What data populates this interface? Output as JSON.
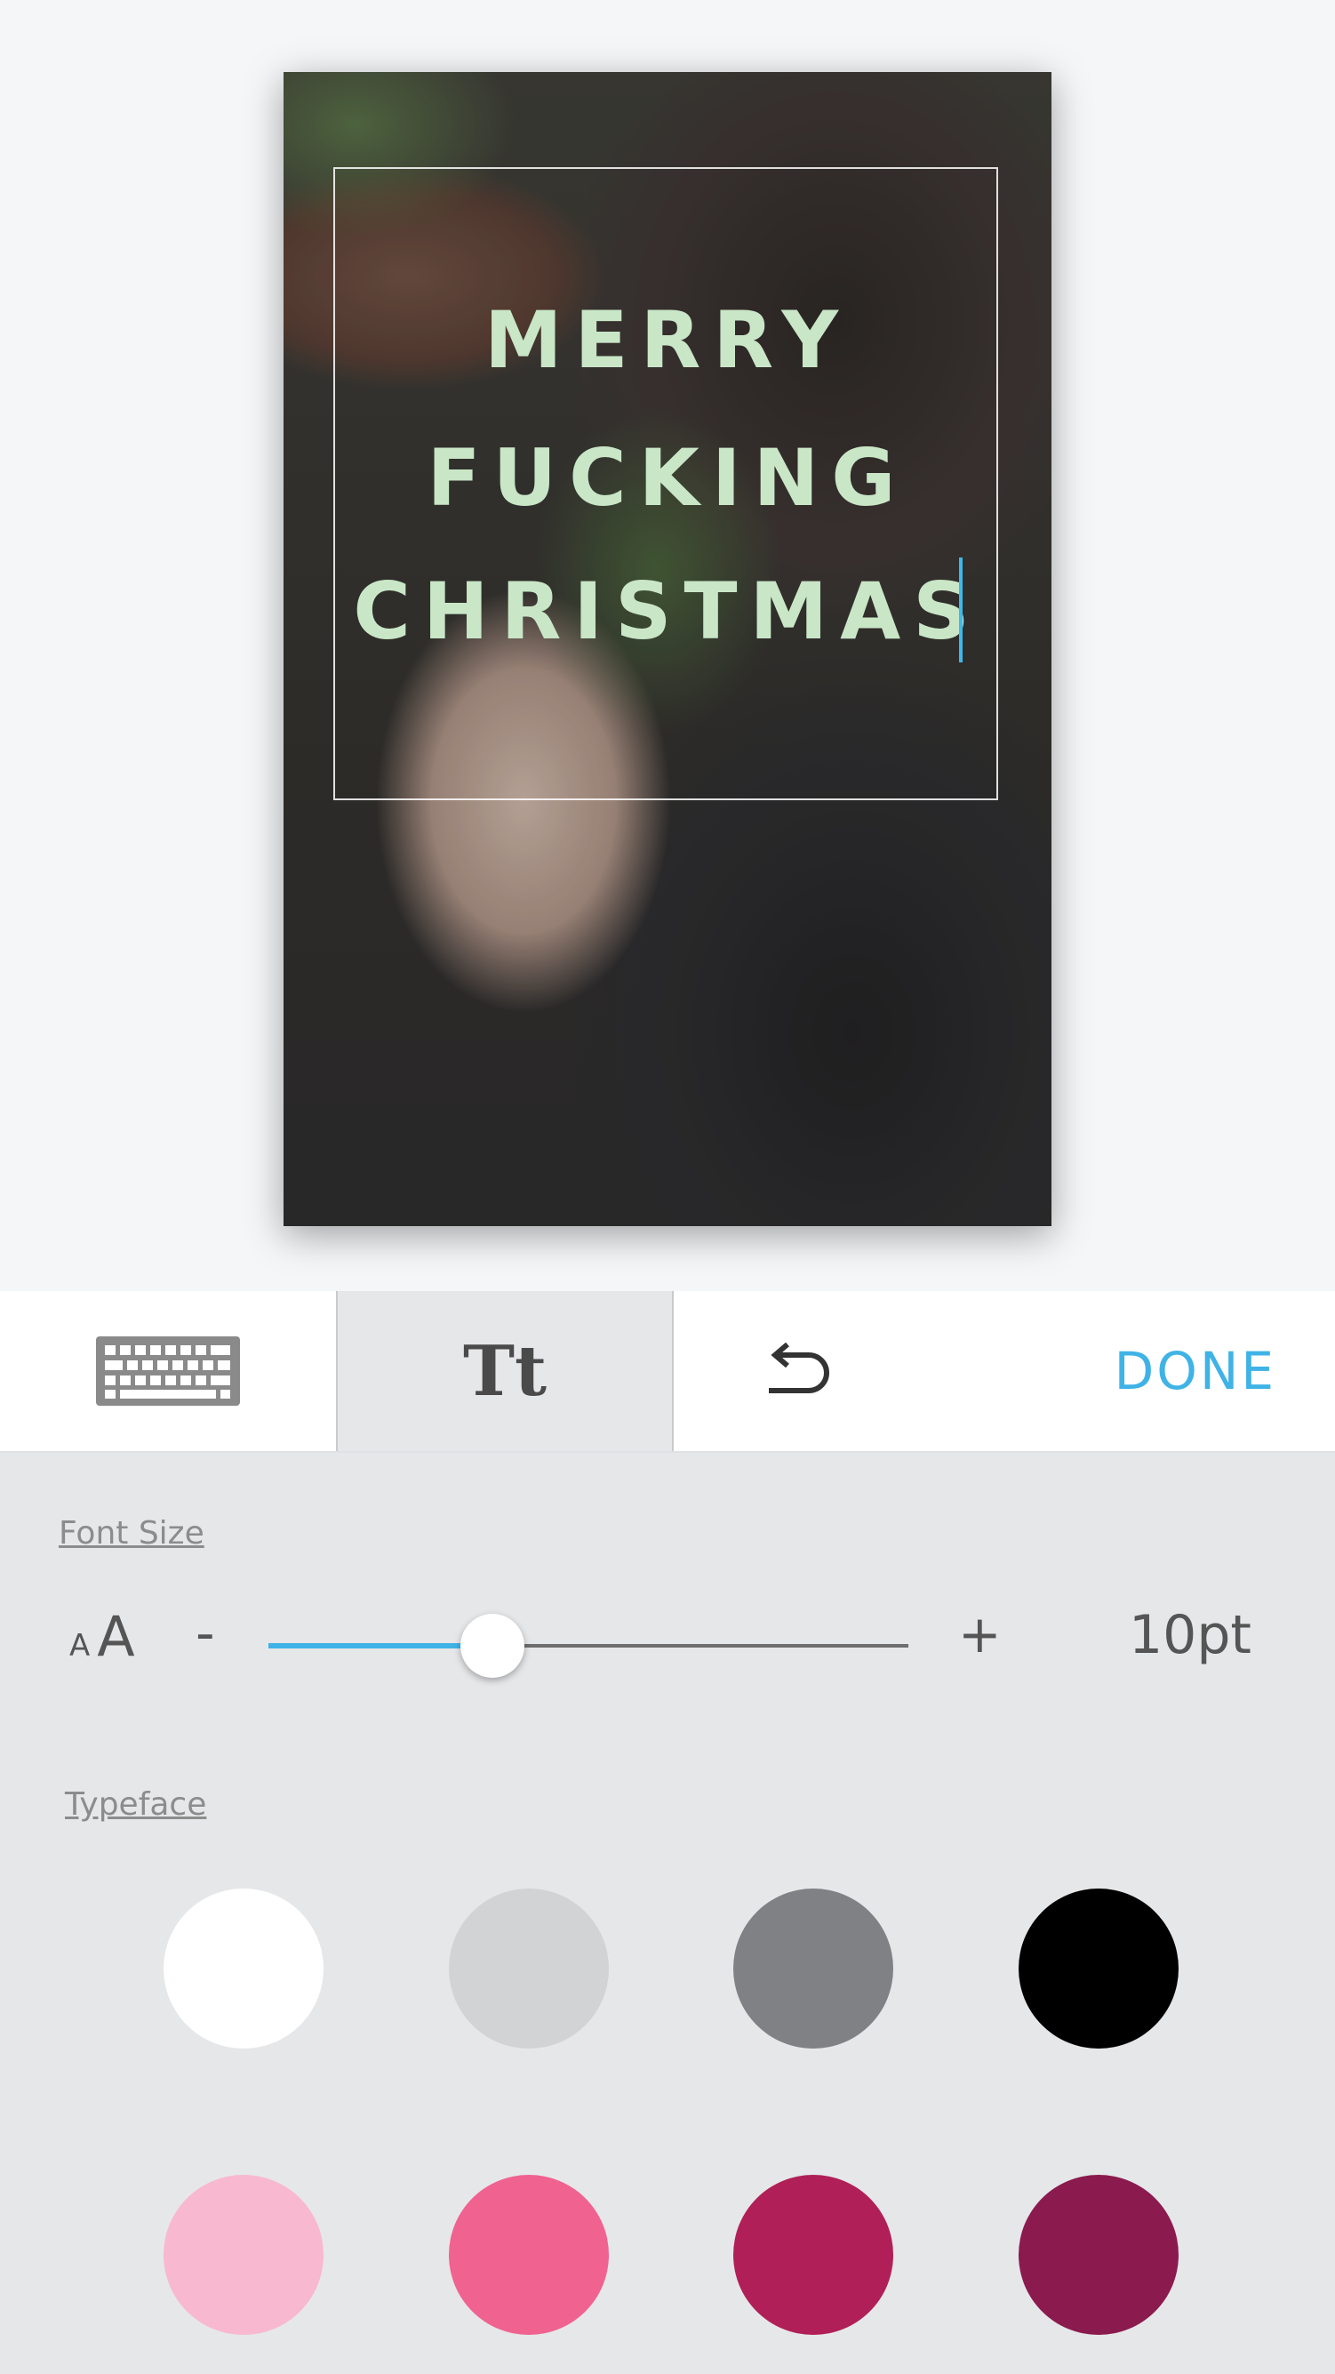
{
  "card": {
    "lines": [
      "MERRY",
      "FUCKING",
      "CHRISTMAS"
    ]
  },
  "toolbar": {
    "keyboard_icon": "keyboard-icon",
    "typeface_label": "Tt",
    "undo_icon": "undo-icon",
    "done_label": "DONE"
  },
  "panel": {
    "font_size_label": "Font Size",
    "size_icon_small": "A",
    "size_icon_large": "A",
    "minus_label": "-",
    "plus_label": "+",
    "font_size_value": "10pt",
    "slider_fraction": 0.35,
    "typeface_label": "Typeface",
    "swatches": [
      "#ffffff",
      "#d2d3d5",
      "#808184",
      "#000000",
      "#f8b8cf",
      "#f06290",
      "#b01f57",
      "#8b1a4e"
    ]
  },
  "colors": {
    "accent": "#3fb3e6",
    "card_text": "#c9e6c7"
  }
}
